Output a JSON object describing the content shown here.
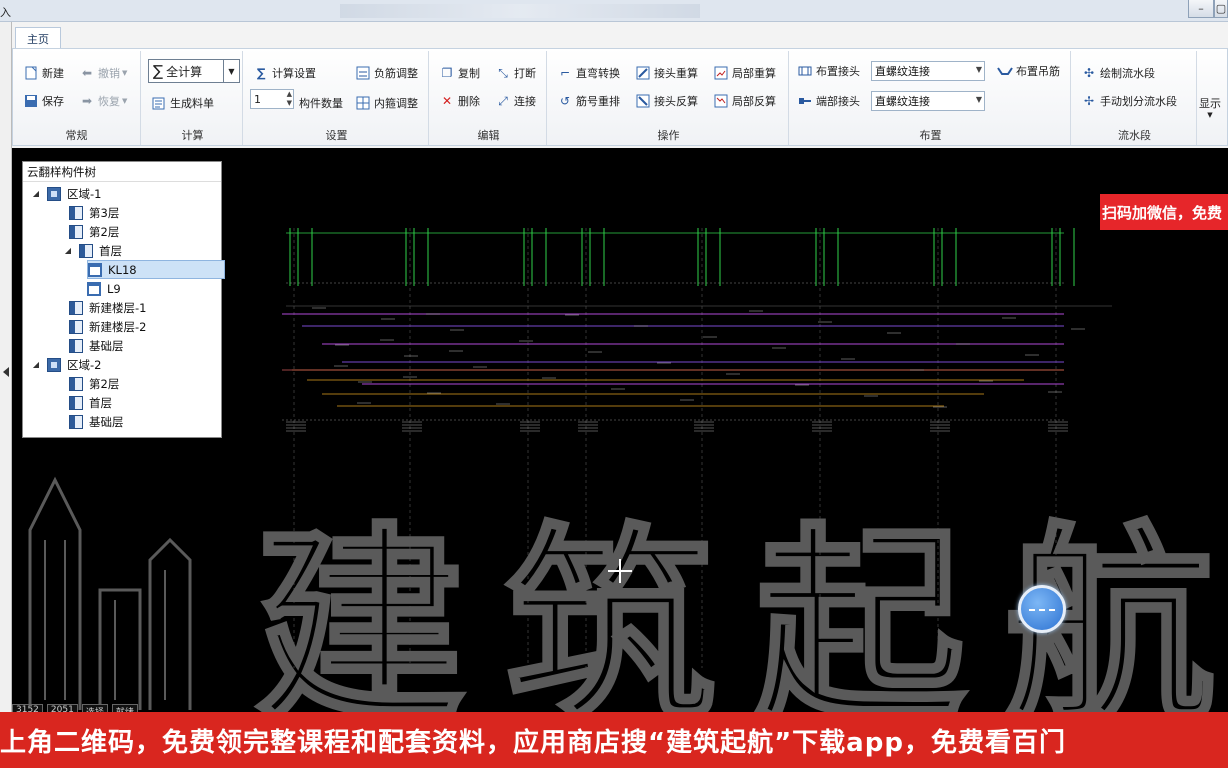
{
  "window": {
    "title_fragment": "入"
  },
  "ribbon": {
    "tab_home": "主页",
    "groups": {
      "general": {
        "label": "常规",
        "new": "新建",
        "save": "保存",
        "undo": "撤销",
        "redo": "恢复"
      },
      "calc": {
        "label": "计算",
        "calc_all": "全计算",
        "generate_list": "生成料单"
      },
      "settings": {
        "label": "设置",
        "calc_settings": "计算设置",
        "negative_rebar": "负筋调整",
        "component_count_value": "1",
        "component_count": "构件数量",
        "inner_anchor": "内箍调整"
      },
      "edit": {
        "label": "编辑",
        "copy": "复制",
        "break": "打断",
        "delete": "删除",
        "connect": "连接"
      },
      "operate": {
        "label": "操作",
        "straight_bend": "直弯转换",
        "joint_recalc": "接头重算",
        "local_recalc": "局部重算",
        "rebar_reorder": "筋号重排",
        "joint_reverse": "接头反算",
        "local_reverse": "局部反算"
      },
      "layout": {
        "label": "布置",
        "place_joint": "布置接头",
        "joint_type_1": "直螺纹连接",
        "place_hanger": "布置吊筋",
        "end_joint": "端部接头",
        "joint_type_2": "直螺纹连接"
      },
      "flow": {
        "label": "流水段",
        "draw_flow": "绘制流水段",
        "manual_flow": "手动划分流水段"
      },
      "display": {
        "label": "显示"
      }
    }
  },
  "tree": {
    "title": "云翻样构件树",
    "nodes": [
      {
        "label": "区域-1",
        "type": "area",
        "level": 0,
        "expanded": true
      },
      {
        "label": "第3层",
        "type": "floor",
        "level": 1
      },
      {
        "label": "第2层",
        "type": "floor",
        "level": 1
      },
      {
        "label": "首层",
        "type": "floor",
        "level": 1,
        "expanded": true
      },
      {
        "label": "KL18",
        "type": "beam",
        "level": 2,
        "selected": true
      },
      {
        "label": "L9",
        "type": "beam",
        "level": 2
      },
      {
        "label": "新建楼层-1",
        "type": "floor",
        "level": 1
      },
      {
        "label": "新建楼层-2",
        "type": "floor",
        "level": 1
      },
      {
        "label": "基础层",
        "type": "floor",
        "level": 1
      },
      {
        "label": "区域-2",
        "type": "area",
        "level": 0,
        "expanded": true
      },
      {
        "label": "第2层",
        "type": "floor",
        "level": 1
      },
      {
        "label": "首层",
        "type": "floor",
        "level": 1
      },
      {
        "label": "基础层",
        "type": "floor",
        "level": 1
      }
    ]
  },
  "status": {
    "coord_x": "3152",
    "coord_y": "2051",
    "mode1": "选择",
    "mode2": "就绪"
  },
  "overlay": {
    "ad_top": "扫码加微信，免费",
    "ad_bottom": "上角二维码，免费领完整课程和配套资料，应用商店搜“建筑起航”下载app，免费看百门",
    "watermark": "建筑起航"
  },
  "colors": {
    "accent": "#e6262a",
    "drawing_bg": "#000000",
    "line_green": "#2fd24a",
    "line_purple": "#b04ad8",
    "line_orange": "#e0a020"
  }
}
